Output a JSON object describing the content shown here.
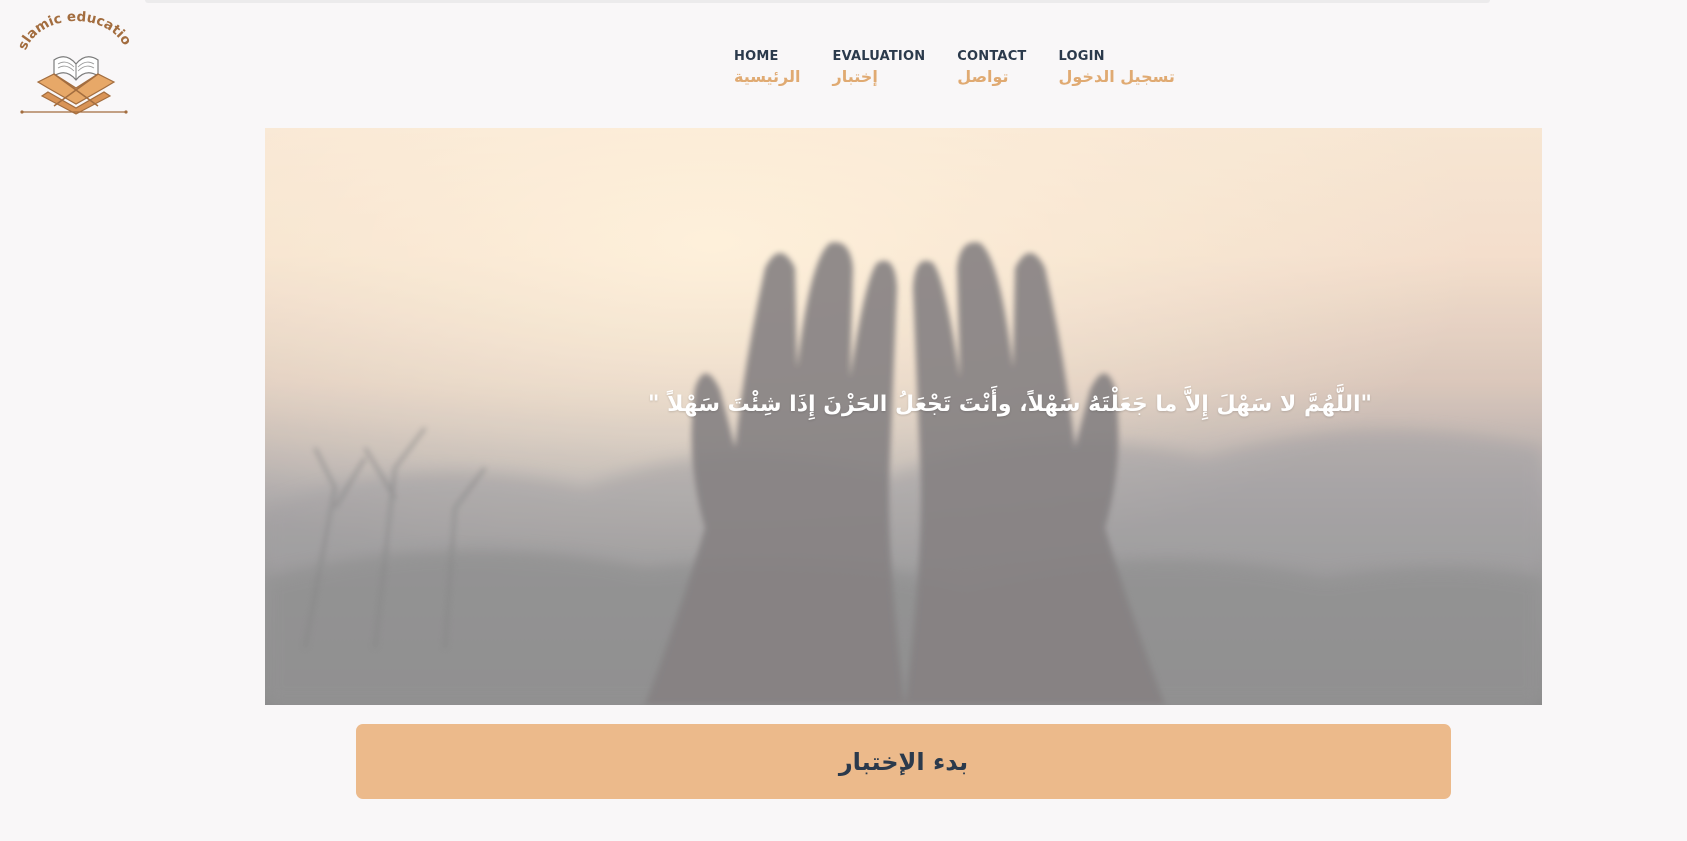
{
  "logo": {
    "text": "islamic education",
    "icon": "quran-on-stand-icon"
  },
  "nav": {
    "items": [
      {
        "en": "HOME",
        "ar": "الرئيسية"
      },
      {
        "en": "EVALUATION",
        "ar": "إختبار"
      },
      {
        "en": "CONTACT",
        "ar": "تواصل"
      },
      {
        "en": "LOGIN",
        "ar": "تسجيل الدخول"
      }
    ]
  },
  "hero": {
    "quote": "\"اللَّهُمَّ لا سَهْلَ إِلاَّ ما جَعَلْتَهُ سَهْلاً، وأَنْتَ تَجْعَلُ الحَزْنَ إِذَا شِئْتَ سَهْلاً \"",
    "image": "praying-hands-image"
  },
  "actions": {
    "start_label": "بدء الإختبار"
  },
  "colors": {
    "accent": "#e0aa72",
    "button": "#ecba8b",
    "text_dark": "#2b3a4c",
    "background": "#f9f7f8"
  }
}
